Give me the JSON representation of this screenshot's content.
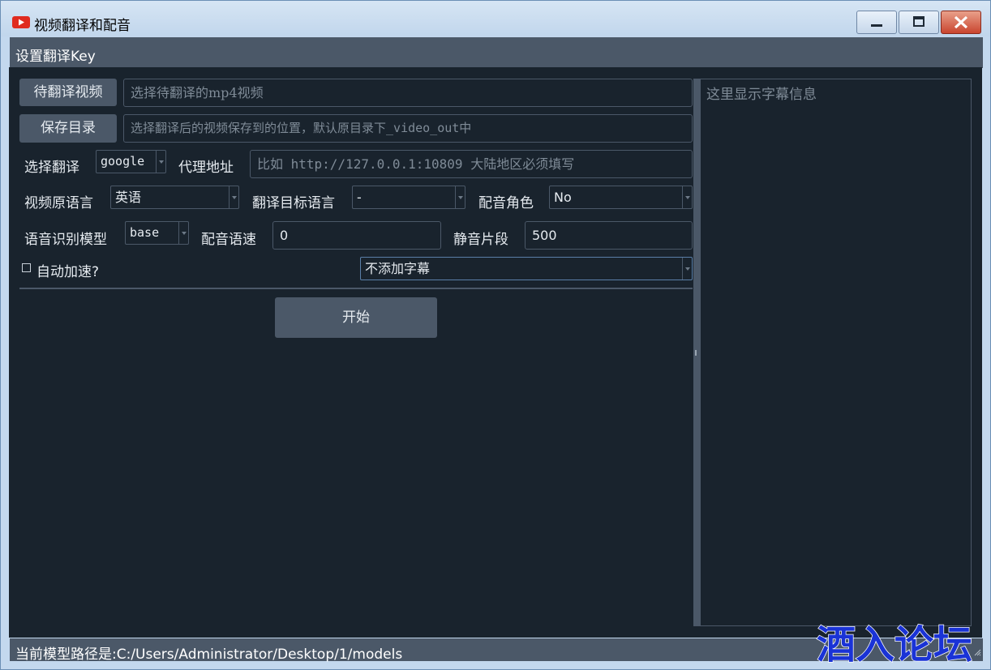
{
  "window": {
    "title": "视频翻译和配音",
    "controls": {
      "minimize": "minimize",
      "maximize": "maximize",
      "close": "close"
    }
  },
  "menubar": {
    "items": [
      {
        "label": "设置翻译Key"
      }
    ]
  },
  "form": {
    "video_button": "待翻译视频",
    "video_input_placeholder": "选择待翻译的mp4视频",
    "save_button": "保存目录",
    "save_input_placeholder": "选择翻译后的视频保存到的位置，默认原目录下_video_out中",
    "translate_label": "选择翻译",
    "translate_value": "google",
    "proxy_label": "代理地址",
    "proxy_placeholder": "比如 http://127.0.0.1:10809 大陆地区必须填写",
    "source_lang_label": "视频原语言",
    "source_lang_value": "英语",
    "target_lang_label": "翻译目标语言",
    "target_lang_value": "-",
    "voice_role_label": "配音角色",
    "voice_role_value": "No",
    "asr_model_label": "语音识别模型",
    "asr_model_value": "base",
    "voice_rate_label": "配音语速",
    "voice_rate_value": "0",
    "silence_label": "静音片段",
    "silence_value": "500",
    "auto_speed_label": "自动加速?",
    "subtitle_option_value": "不添加字幕",
    "start_button": "开始"
  },
  "subtitle_panel": {
    "placeholder": "这里显示字幕信息"
  },
  "statusbar": {
    "text": "当前模型路径是:C:/Users/Administrator/Desktop/1/models"
  },
  "watermark": {
    "text": "酒入论坛"
  },
  "icons": {
    "app": "video-play-icon",
    "minimize": "minimize-icon",
    "maximize": "maximize-icon",
    "close": "close-icon"
  },
  "colors": {
    "background": "#19232d",
    "panel": "#4b5868",
    "text": "#e6ebf0",
    "placeholder": "#7f8b97",
    "watermark": "#1a33d6"
  }
}
